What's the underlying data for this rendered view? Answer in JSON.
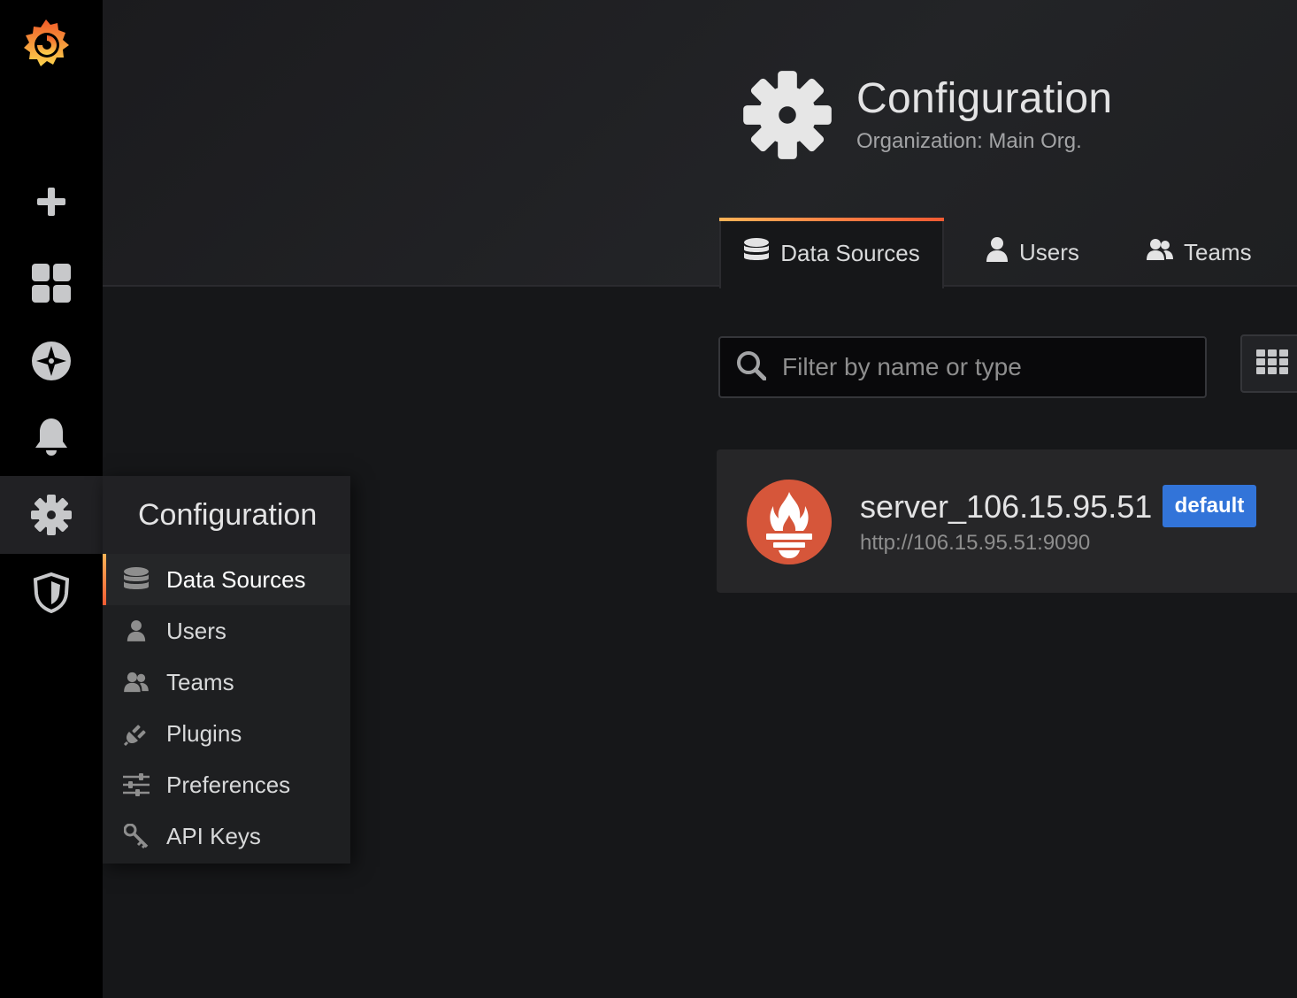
{
  "sidebar": {
    "logo": "grafana-logo",
    "items": [
      {
        "name": "plus-icon"
      },
      {
        "name": "dashboards-icon"
      },
      {
        "name": "explore-compass-icon"
      },
      {
        "name": "alerting-bell-icon"
      },
      {
        "name": "configuration-gear-icon",
        "active": true
      },
      {
        "name": "server-admin-shield-icon"
      }
    ]
  },
  "header": {
    "title": "Configuration",
    "subtitle": "Organization: Main Org.",
    "tabs": [
      {
        "label": "Data Sources",
        "icon": "database-icon",
        "active": true
      },
      {
        "label": "Users",
        "icon": "user-icon"
      },
      {
        "label": "Teams",
        "icon": "users-icon"
      }
    ]
  },
  "filter": {
    "placeholder": "Filter by name or type",
    "value": ""
  },
  "datasources": [
    {
      "name": "server_106.15.95.51",
      "url": "http://106.15.95.51:9090",
      "badge": "default",
      "type_icon": "prometheus-icon"
    }
  ],
  "flyout": {
    "title": "Configuration",
    "items": [
      {
        "label": "Data Sources",
        "icon": "database-icon",
        "active": true
      },
      {
        "label": "Users",
        "icon": "user-icon"
      },
      {
        "label": "Teams",
        "icon": "users-icon"
      },
      {
        "label": "Plugins",
        "icon": "plug-icon"
      },
      {
        "label": "Preferences",
        "icon": "sliders-icon"
      },
      {
        "label": "API Keys",
        "icon": "key-icon"
      }
    ]
  },
  "colors": {
    "accent_orange": "#f15b33",
    "badge_blue": "#3274d9",
    "prometheus": "#d6563a"
  }
}
